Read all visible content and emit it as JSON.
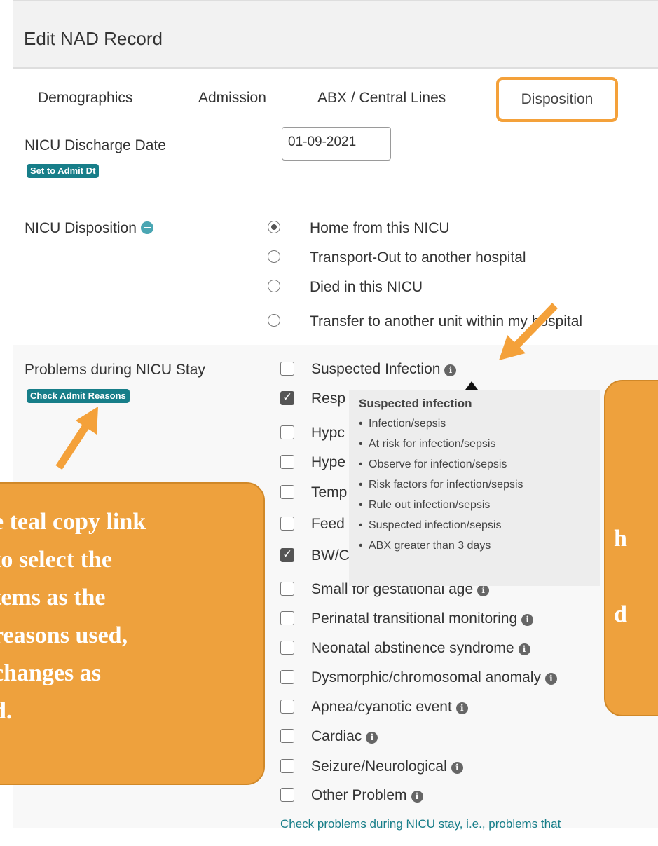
{
  "header": {
    "title": "Edit NAD Record"
  },
  "tabs": [
    {
      "label": "Demographics",
      "active": false
    },
    {
      "label": "Admission",
      "active": false
    },
    {
      "label": "ABX / Central Lines",
      "active": false
    },
    {
      "label": "Disposition",
      "active": true
    }
  ],
  "discharge": {
    "label": "NICU Discharge Date",
    "badge": "Set to Admit Dt",
    "value": "01-09-2021"
  },
  "disposition": {
    "label": "NICU Disposition",
    "options": [
      {
        "label": "Home from this NICU",
        "selected": true
      },
      {
        "label": "Transport-Out to another hospital",
        "selected": false
      },
      {
        "label": "Died in this NICU",
        "selected": false
      },
      {
        "label": "Transfer to another unit within my hospital",
        "selected": false
      }
    ]
  },
  "problems": {
    "label": "Problems during NICU Stay",
    "badge": "Check Admit Reasons",
    "items": [
      {
        "label": "Suspected Infection",
        "checked": false
      },
      {
        "label": "Resp",
        "checked": true
      },
      {
        "label": "Hypc",
        "checked": false
      },
      {
        "label": "Hype",
        "checked": false
      },
      {
        "label": "Temp",
        "checked": false
      },
      {
        "label": "Feed",
        "checked": false
      },
      {
        "label": "BW/C",
        "checked": true
      },
      {
        "label": "Small for gestational age",
        "checked": false
      },
      {
        "label": "Perinatal transitional monitoring",
        "checked": false
      },
      {
        "label": "Neonatal abstinence syndrome",
        "checked": false
      },
      {
        "label": "Dysmorphic/chromosomal anomaly",
        "checked": false
      },
      {
        "label": "Apnea/cyanotic event",
        "checked": false
      },
      {
        "label": "Cardiac",
        "checked": false
      },
      {
        "label": "Seizure/Neurological",
        "checked": false
      },
      {
        "label": "Other Problem",
        "checked": false
      }
    ],
    "hint": "Check problems during NICU stay, i.e., problems that"
  },
  "tooltip": {
    "title": "Suspected infection",
    "items": [
      "Infection/sepsis",
      "At risk for infection/sepsis",
      "Observe for infection/sepsis",
      "Risk factors for infection/sepsis",
      "Rule out infection/sepsis",
      "Suspected infection/sepsis",
      "ABX greater than 3 days"
    ]
  },
  "callout_left": {
    "lines": [
      "e teal copy link",
      "to select the",
      "tems as the",
      "reasons used,",
      "changes as",
      "d."
    ]
  },
  "callout_right": {
    "lines": [
      "h",
      "",
      "d"
    ]
  },
  "colors": {
    "accent": "#f4a13a",
    "teal": "#177e89",
    "callout": "#eea13d"
  }
}
